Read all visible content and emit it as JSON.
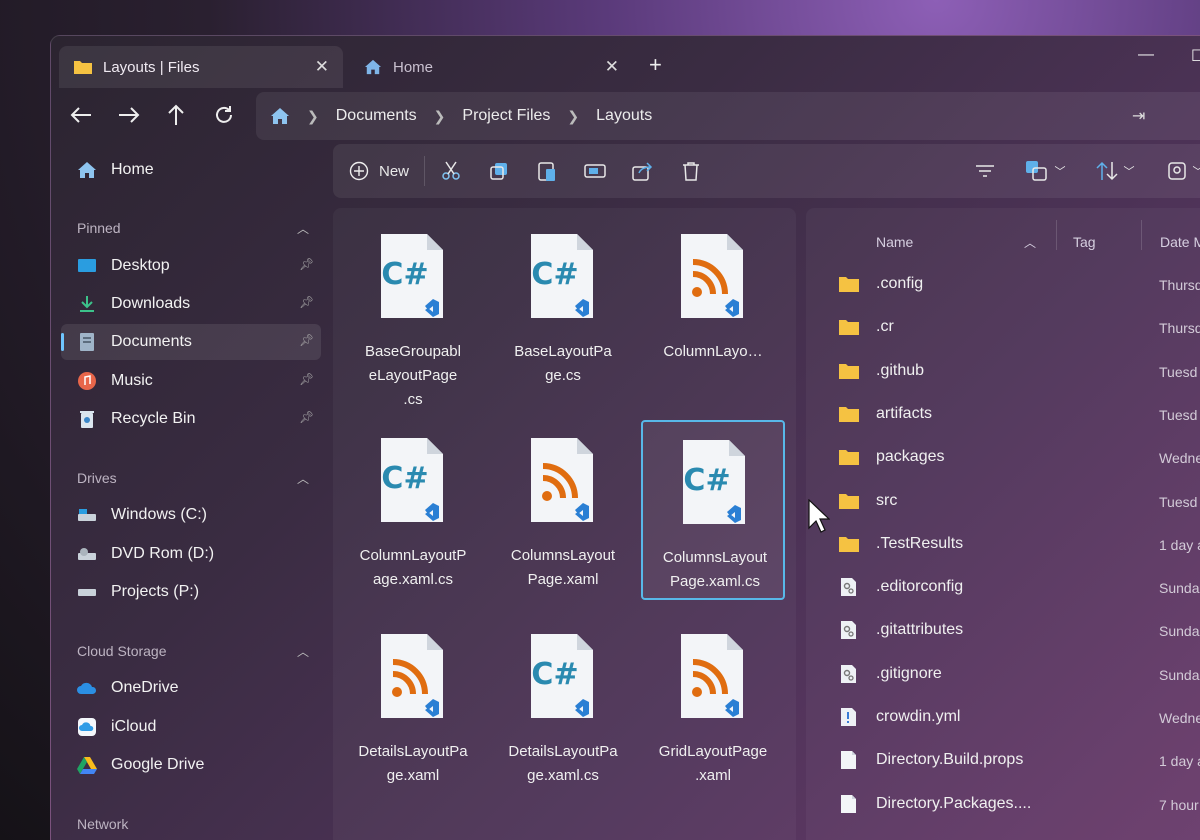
{
  "tabs": [
    {
      "label": "Layouts | Files",
      "icon": "folder-icon",
      "active": true
    },
    {
      "label": "Home",
      "icon": "home-icon",
      "active": false
    }
  ],
  "address": {
    "crumbs": [
      "Documents",
      "Project Files",
      "Layouts"
    ]
  },
  "sidebar": {
    "home": "Home",
    "pinned_title": "Pinned",
    "pinned": [
      {
        "label": "Desktop",
        "icon": "desktop-icon"
      },
      {
        "label": "Downloads",
        "icon": "download-icon"
      },
      {
        "label": "Documents",
        "icon": "documents-icon",
        "selected": true
      },
      {
        "label": "Music",
        "icon": "music-icon"
      },
      {
        "label": "Recycle Bin",
        "icon": "recycle-bin-icon"
      }
    ],
    "drives_title": "Drives",
    "drives": [
      {
        "label": "Windows (C:)",
        "icon": "drive-icon"
      },
      {
        "label": "DVD Rom (D:)",
        "icon": "dvd-drive-icon"
      },
      {
        "label": "Projects (P:)",
        "icon": "drive-icon"
      }
    ],
    "cloud_title": "Cloud Storage",
    "cloud": [
      {
        "label": "OneDrive",
        "icon": "onedrive-icon"
      },
      {
        "label": "iCloud",
        "icon": "icloud-icon"
      },
      {
        "label": "Google Drive",
        "icon": "google-drive-icon"
      }
    ],
    "network_title": "Network"
  },
  "toolbar": {
    "new_label": "New"
  },
  "grid": {
    "tiles": [
      {
        "name": "BaseGroupableLayoutPage.cs",
        "label_lines": [
          "BaseGroupabl",
          "eLayoutPage",
          ".cs"
        ],
        "kind": "csharp"
      },
      {
        "name": "BaseLayoutPage.cs",
        "label_lines": [
          "BaseLayoutPa",
          "ge.cs"
        ],
        "kind": "csharp"
      },
      {
        "name": "ColumnLayo…",
        "label_lines": [
          "ColumnLayo…"
        ],
        "kind": "xaml"
      },
      {
        "name": "ColumnLayoutPage.xaml.cs",
        "label_lines": [
          "ColumnLayoutP",
          "age.xaml.cs"
        ],
        "kind": "csharp"
      },
      {
        "name": "ColumnsLayoutPage.xaml",
        "label_lines": [
          "ColumnsLayout",
          "Page.xaml"
        ],
        "kind": "xaml"
      },
      {
        "name": "ColumnsLayoutPage.xaml.cs",
        "label_lines": [
          "ColumnsLayout",
          "Page.xaml.cs"
        ],
        "kind": "csharp",
        "selected": true
      },
      {
        "name": "DetailsLayoutPage.xaml",
        "label_lines": [
          "DetailsLayoutPa",
          "ge.xaml"
        ],
        "kind": "xaml"
      },
      {
        "name": "DetailsLayoutPage.xaml.cs",
        "label_lines": [
          "DetailsLayoutPa",
          "ge.xaml.cs"
        ],
        "kind": "csharp"
      },
      {
        "name": "GridLayoutPage.xaml",
        "label_lines": [
          "GridLayoutPage",
          ".xaml"
        ],
        "kind": "xaml"
      }
    ]
  },
  "details": {
    "columns": {
      "name": "Name",
      "tag": "Tag",
      "date": "Date M"
    },
    "rows": [
      {
        "name": ".config",
        "date": "Thursd",
        "kind": "folder"
      },
      {
        "name": ".cr",
        "date": "Thursd",
        "kind": "folder"
      },
      {
        "name": ".github",
        "date": "Tuesd",
        "kind": "folder"
      },
      {
        "name": "artifacts",
        "date": "Tuesd",
        "kind": "folder"
      },
      {
        "name": "packages",
        "date": "Wedne",
        "kind": "folder"
      },
      {
        "name": "src",
        "date": "Tuesd",
        "kind": "folder"
      },
      {
        "name": ".TestResults",
        "date": "1 day a",
        "kind": "folder"
      },
      {
        "name": ".editorconfig",
        "date": "Sunda",
        "kind": "config"
      },
      {
        "name": ".gitattributes",
        "date": "Sunda",
        "kind": "config"
      },
      {
        "name": ".gitignore",
        "date": "Sunda",
        "kind": "config"
      },
      {
        "name": "crowdin.yml",
        "date": "Wedne",
        "kind": "yml"
      },
      {
        "name": "Directory.Build.props",
        "date": "1 day a",
        "kind": "file"
      },
      {
        "name": "Directory.Packages....",
        "date": "7 hour",
        "kind": "file"
      }
    ]
  },
  "colors": {
    "accent": "#58b8e8",
    "csharp": "#2a8ab0",
    "xaml": "#e06d10",
    "folder": "#f5c242"
  }
}
